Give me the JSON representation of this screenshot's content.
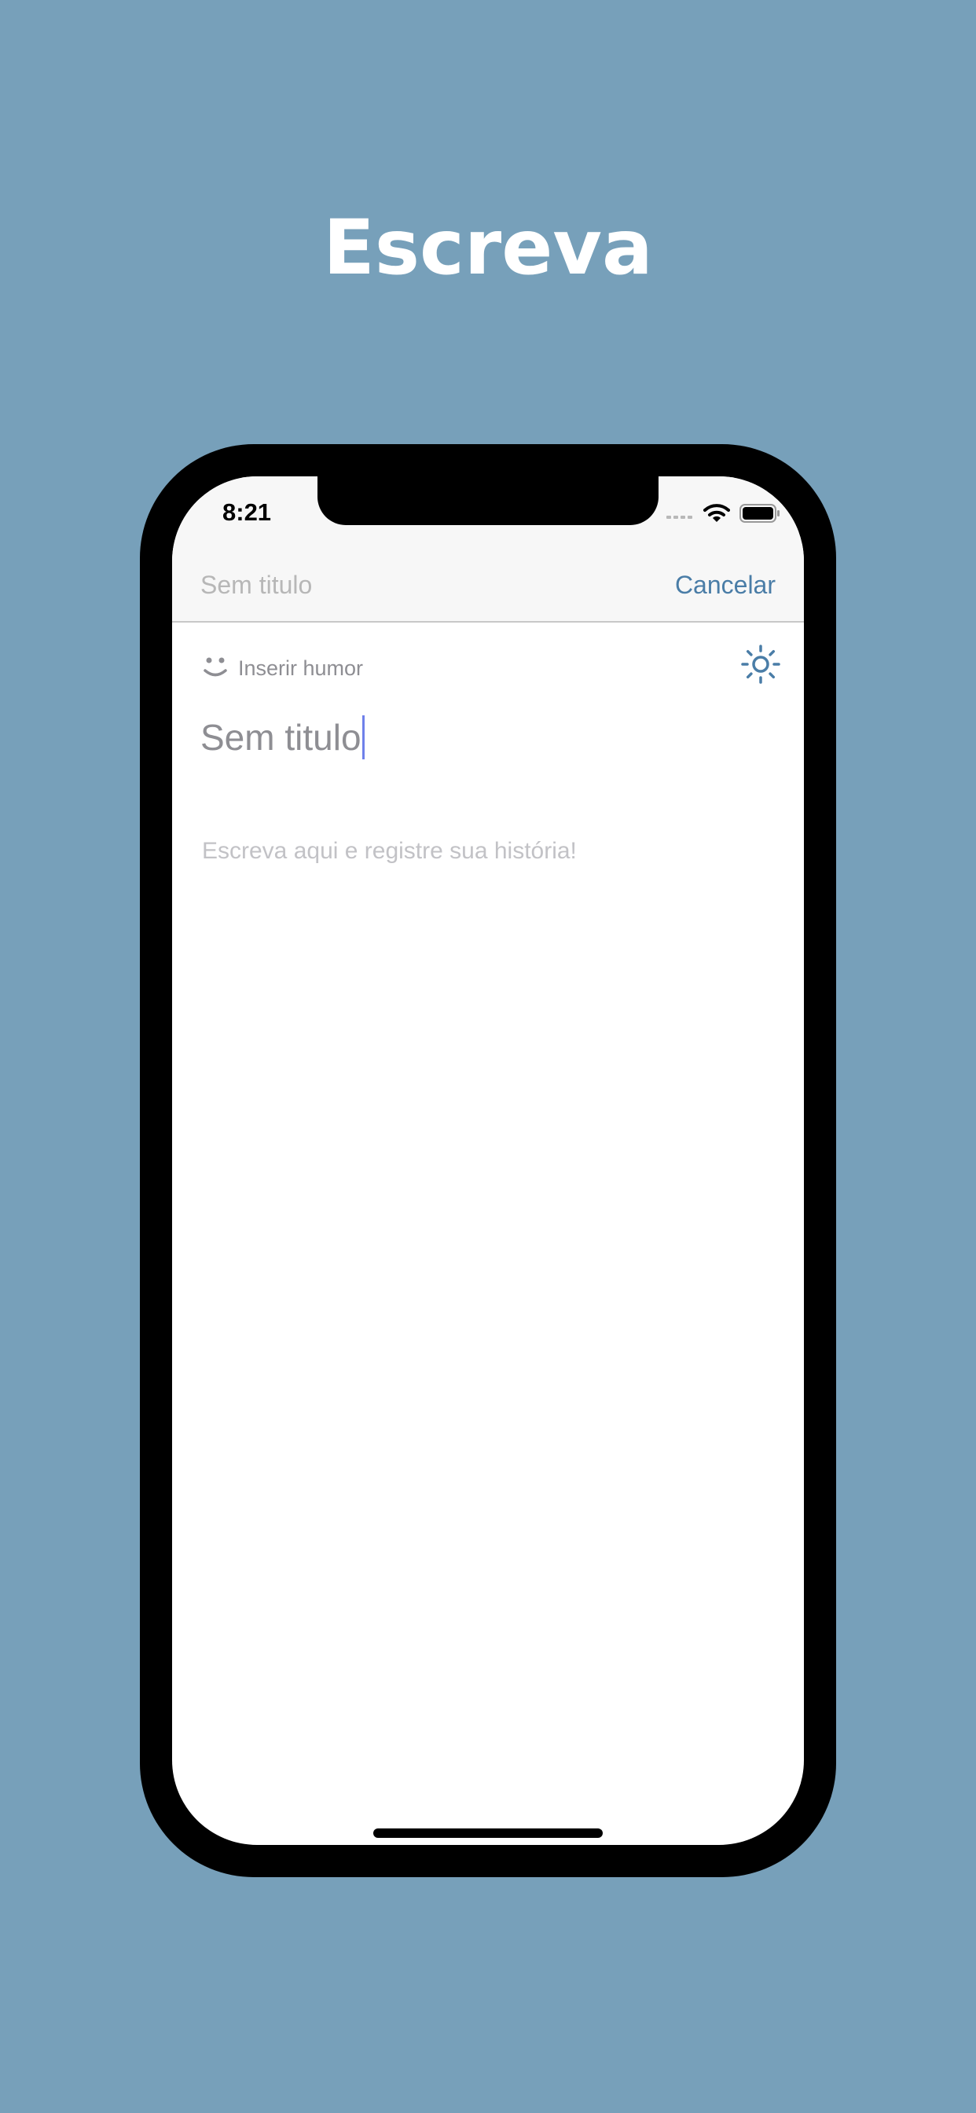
{
  "headline": "Escreva",
  "status_bar": {
    "time": "8:21",
    "icons": [
      "cellular-signal-icon",
      "wifi-icon",
      "battery-icon"
    ]
  },
  "nav_bar": {
    "title": "Sem titulo",
    "cancel_label": "Cancelar"
  },
  "editor": {
    "mood_label": "Inserir humor",
    "mood_icon": "smiley-icon",
    "theme_icon": "sun-icon",
    "title_value": "Sem titulo",
    "body_placeholder": "Escreva aqui e registre sua história!"
  },
  "colors": {
    "background": "#77a0ba",
    "accent": "#4a7da7",
    "caret": "#6f80ea",
    "placeholder": "#c2c2c6"
  }
}
